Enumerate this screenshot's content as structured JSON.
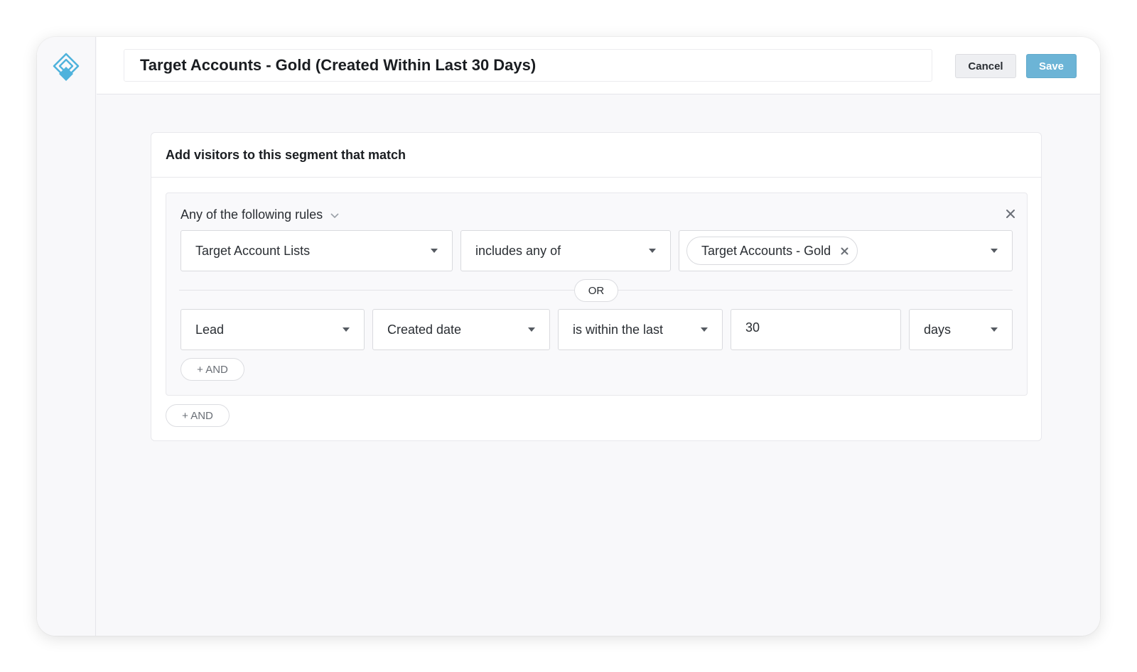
{
  "header": {
    "segment_title": "Target Accounts - Gold (Created Within Last 30 Days)",
    "cancel_label": "Cancel",
    "save_label": "Save"
  },
  "icons": {
    "logo": "diamond-logo-icon",
    "group_toggle": "chevron-down-icon",
    "group_close": "close-icon",
    "tag_remove": "close-icon",
    "dropdown": "caret-down-icon"
  },
  "colors": {
    "accent": "#6cb4d6",
    "logo": "#4fb2dc"
  },
  "panel": {
    "heading": "Add visitors to this segment that match",
    "group": {
      "match_mode": "Any of the following rules",
      "rule1": {
        "field": "Target Account Lists",
        "operator": "includes any of",
        "selected_tag": "Target Accounts - Gold"
      },
      "or_label": "OR",
      "rule2": {
        "object": "Lead",
        "field": "Created date",
        "operator": "is within the last",
        "value": "30",
        "unit": "days"
      },
      "add_and_label": "+ AND"
    },
    "add_and_label": "+ AND"
  }
}
